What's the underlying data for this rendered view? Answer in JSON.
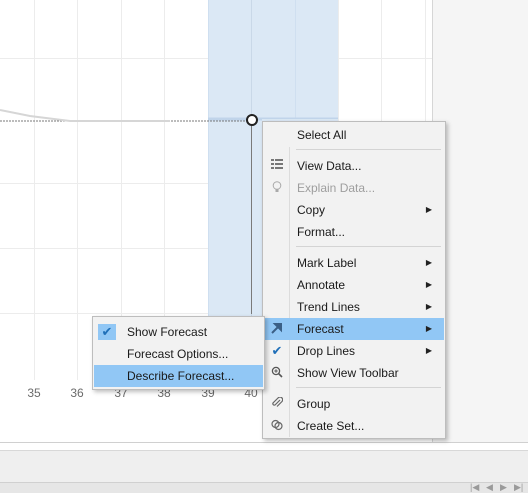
{
  "axis": {
    "ticks": [
      "35",
      "36",
      "37",
      "38",
      "39",
      "40"
    ]
  },
  "context_menu": {
    "items": [
      {
        "label": "Select All",
        "icon": "",
        "disabled": false,
        "submenu": false,
        "checked": false
      },
      {
        "label": "View Data...",
        "icon": "table-icon",
        "disabled": false,
        "submenu": false,
        "checked": false
      },
      {
        "label": "Explain Data...",
        "icon": "lightbulb-icon",
        "disabled": true,
        "submenu": false,
        "checked": false
      },
      {
        "label": "Copy",
        "icon": "",
        "disabled": false,
        "submenu": true,
        "checked": false
      },
      {
        "label": "Format...",
        "icon": "",
        "disabled": false,
        "submenu": false,
        "checked": false
      },
      {
        "label": "Mark Label",
        "icon": "",
        "disabled": false,
        "submenu": true,
        "checked": false
      },
      {
        "label": "Annotate",
        "icon": "",
        "disabled": false,
        "submenu": true,
        "checked": false
      },
      {
        "label": "Trend Lines",
        "icon": "",
        "disabled": false,
        "submenu": true,
        "checked": false
      },
      {
        "label": "Forecast",
        "icon": "forecast-arrow-icon",
        "disabled": false,
        "submenu": true,
        "checked": false,
        "highlighted": true
      },
      {
        "label": "Drop Lines",
        "icon": "checkmark-icon",
        "disabled": false,
        "submenu": true,
        "checked": true
      },
      {
        "label": "Show View Toolbar",
        "icon": "zoom-icon",
        "disabled": false,
        "submenu": false,
        "checked": false
      },
      {
        "label": "Group",
        "icon": "paperclip-icon",
        "disabled": false,
        "submenu": false,
        "checked": false
      },
      {
        "label": "Create Set...",
        "icon": "set-icon",
        "disabled": false,
        "submenu": false,
        "checked": false
      }
    ]
  },
  "forecast_submenu": {
    "items": [
      {
        "label": "Show Forecast",
        "checked": true
      },
      {
        "label": "Forecast Options...",
        "checked": false
      },
      {
        "label": "Describe Forecast...",
        "checked": false,
        "highlighted": true
      }
    ]
  },
  "colors": {
    "highlight": "#91c7f5",
    "forecast_band": "#dbe8f5",
    "menu_bg": "#f2f2f2"
  }
}
